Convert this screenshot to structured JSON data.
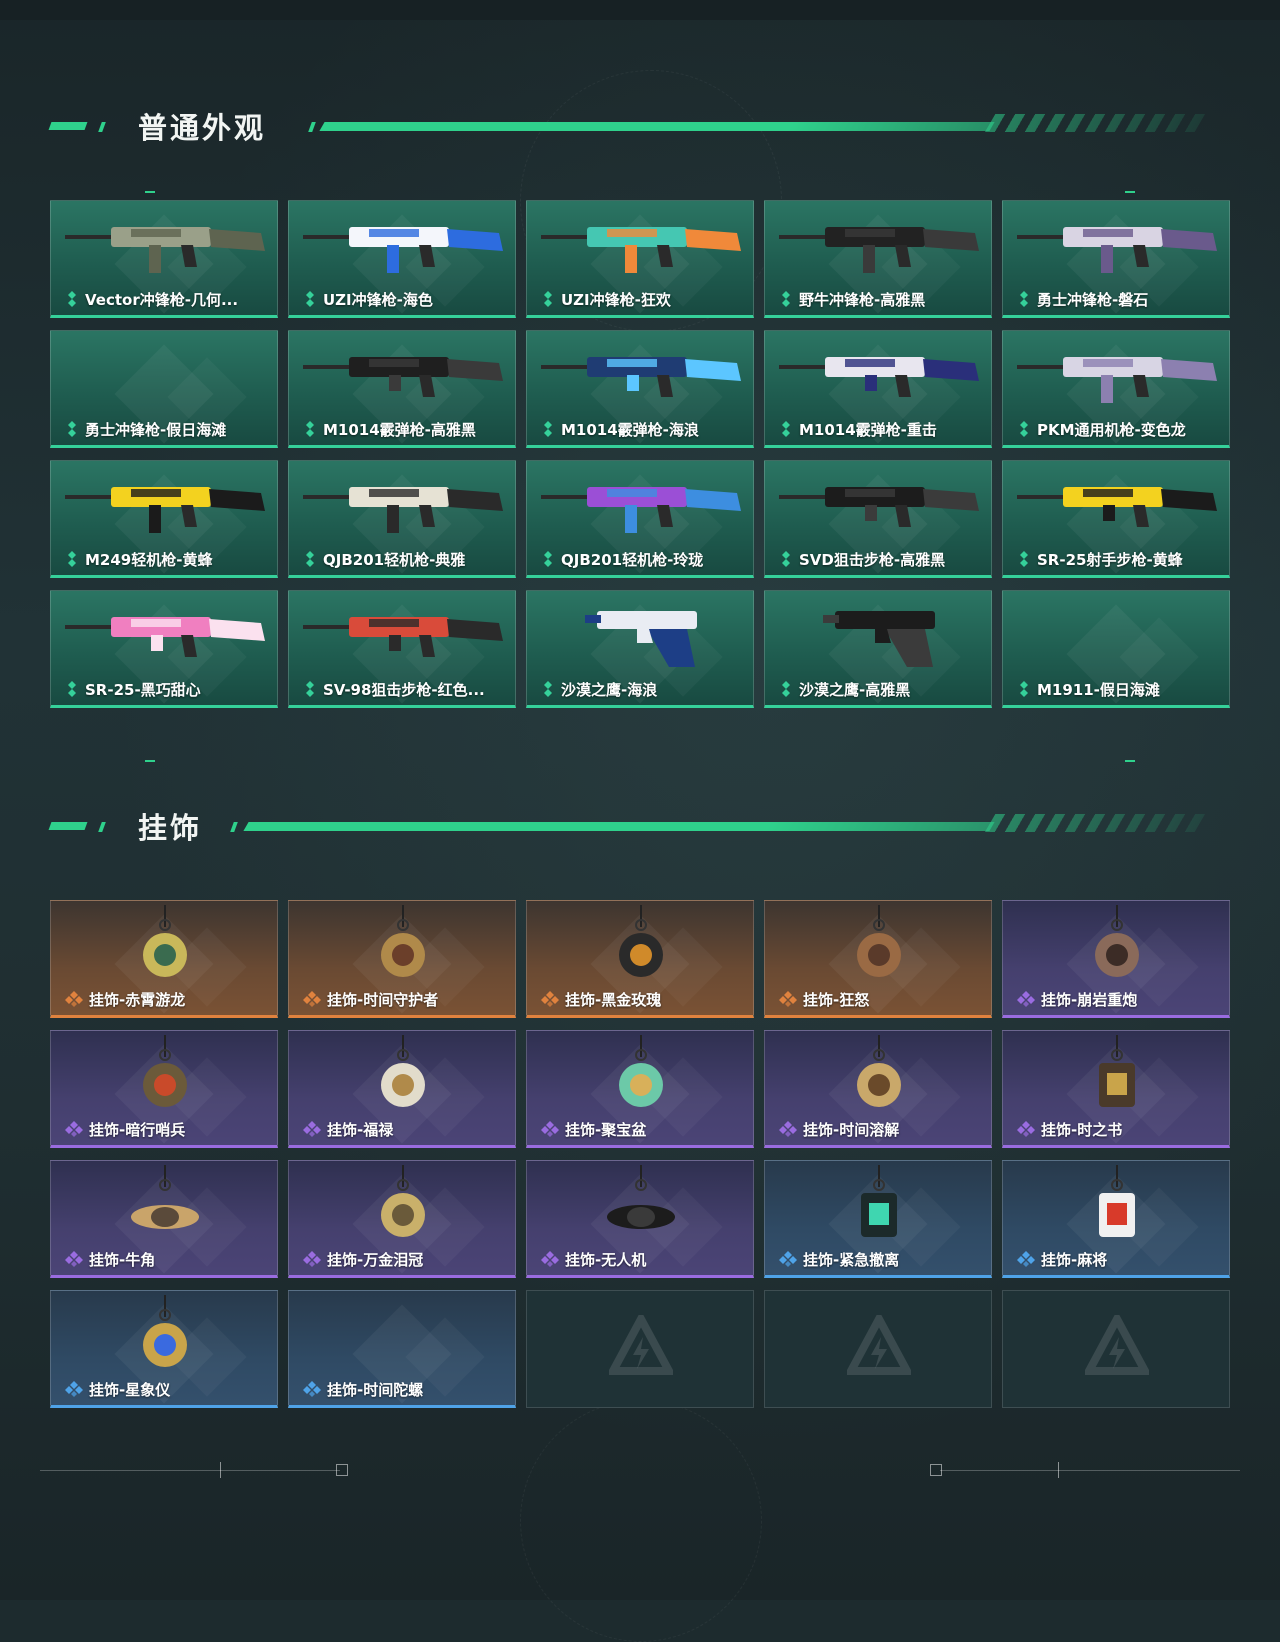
{
  "sections": {
    "normal": {
      "title": "普通外观"
    },
    "charms": {
      "title": "挂饰"
    }
  },
  "colors": {
    "accent": "#2fd18c",
    "rarity_green": "#35d19a",
    "rarity_orange": "#e0823e",
    "rarity_purple": "#9a6ce0",
    "rarity_blue": "#4fa3e8"
  },
  "skins": [
    {
      "label": "Vector冲锋枪-几何...",
      "rarity": "green",
      "icon": "smg-vector-icon",
      "colors": [
        "#9aa089",
        "#5e6450"
      ]
    },
    {
      "label": "UZI冲锋枪-海色",
      "rarity": "green",
      "icon": "smg-uzi-icon",
      "colors": [
        "#f4f6fb",
        "#2d6cdf"
      ]
    },
    {
      "label": "UZI冲锋枪-狂欢",
      "rarity": "green",
      "icon": "smg-uzi-icon",
      "colors": [
        "#45c7b2",
        "#f0893a"
      ]
    },
    {
      "label": "野牛冲锋枪-高雅黑",
      "rarity": "green",
      "icon": "smg-bizon-icon",
      "colors": [
        "#222222",
        "#3a3a3a"
      ]
    },
    {
      "label": "勇士冲锋枪-磐石",
      "rarity": "green",
      "icon": "smg-warrior-icon",
      "colors": [
        "#d9d4e3",
        "#6a5a8c"
      ]
    },
    {
      "label": "勇士冲锋枪-假日海滩",
      "rarity": "green",
      "icon": "",
      "colors": []
    },
    {
      "label": "M1014霰弹枪-高雅黑",
      "rarity": "green",
      "icon": "shotgun-m1014-icon",
      "colors": [
        "#1f1f1f",
        "#3a3a3a"
      ]
    },
    {
      "label": "M1014霰弹枪-海浪",
      "rarity": "green",
      "icon": "shotgun-m1014-icon",
      "colors": [
        "#1f3c73",
        "#5cc6ff"
      ]
    },
    {
      "label": "M1014霰弹枪-重击",
      "rarity": "green",
      "icon": "shotgun-m1014-icon",
      "colors": [
        "#e8e6ef",
        "#2a2f7a"
      ]
    },
    {
      "label": "PKM通用机枪-变色龙",
      "rarity": "green",
      "icon": "mg-pkm-icon",
      "colors": [
        "#d8d5e4",
        "#8c80b0"
      ]
    },
    {
      "label": "M249轻机枪-黄蜂",
      "rarity": "green",
      "icon": "mg-m249-icon",
      "colors": [
        "#f3d21f",
        "#1b1b1b"
      ]
    },
    {
      "label": "QJB201轻机枪-典雅",
      "rarity": "green",
      "icon": "mg-qjb201-icon",
      "colors": [
        "#e6e2d4",
        "#2a2a2a"
      ]
    },
    {
      "label": "QJB201轻机枪-玲珑",
      "rarity": "green",
      "icon": "mg-qjb201-icon",
      "colors": [
        "#9b4fd6",
        "#3d8ee0"
      ]
    },
    {
      "label": "SVD狙击步枪-高雅黑",
      "rarity": "green",
      "icon": "sniper-svd-icon",
      "colors": [
        "#1c1c1c",
        "#3b3b3b"
      ]
    },
    {
      "label": "SR-25射手步枪-黄蜂",
      "rarity": "green",
      "icon": "dmr-sr25-icon",
      "colors": [
        "#f3d21f",
        "#1b1b1b"
      ]
    },
    {
      "label": "SR-25-黑巧甜心",
      "rarity": "green",
      "icon": "dmr-sr25-icon",
      "colors": [
        "#f07fc0",
        "#fbe1ef"
      ]
    },
    {
      "label": "SV-98狙击步枪-红色...",
      "rarity": "green",
      "icon": "sniper-sv98-icon",
      "colors": [
        "#d94b3a",
        "#2a2a2a"
      ]
    },
    {
      "label": "沙漠之鹰-海浪",
      "rarity": "green",
      "icon": "pistol-deagle-icon",
      "colors": [
        "#e9ecf3",
        "#1d3e86"
      ]
    },
    {
      "label": "沙漠之鹰-高雅黑",
      "rarity": "green",
      "icon": "pistol-deagle-icon",
      "colors": [
        "#1c1c1c",
        "#3b3b3b"
      ]
    },
    {
      "label": "M1911-假日海滩",
      "rarity": "green",
      "icon": "",
      "colors": []
    }
  ],
  "charms": [
    {
      "label": "挂饰-赤霄游龙",
      "rarity": "orange",
      "icon": "dragon-charm-icon",
      "colors": [
        "#c9b85a",
        "#3a6b4f"
      ]
    },
    {
      "label": "挂饰-时间守护者",
      "rarity": "orange",
      "icon": "pendulum-charm-icon",
      "colors": [
        "#b08a4a",
        "#6b3f2a"
      ]
    },
    {
      "label": "挂饰-黑金玫瑰",
      "rarity": "orange",
      "icon": "rose-charm-icon",
      "colors": [
        "#2a2a2a",
        "#d08a2a"
      ]
    },
    {
      "label": "挂饰-狂怒",
      "rarity": "orange",
      "icon": "key-charm-icon",
      "colors": [
        "#9a6a44",
        "#5a3a2a"
      ]
    },
    {
      "label": "挂饰-崩岩重炮",
      "rarity": "purple",
      "icon": "golem-charm-icon",
      "colors": [
        "#8a6a5a",
        "#3c2c26"
      ]
    },
    {
      "label": "挂饰-暗行哨兵",
      "rarity": "purple",
      "icon": "sentinel-charm-icon",
      "colors": [
        "#6b5a3a",
        "#c94a2a"
      ]
    },
    {
      "label": "挂饰-福禄",
      "rarity": "purple",
      "icon": "gourd-charm-icon",
      "colors": [
        "#e2dccb",
        "#b08a4a"
      ]
    },
    {
      "label": "挂饰-聚宝盆",
      "rarity": "purple",
      "icon": "treasure-bowl-charm-icon",
      "colors": [
        "#6cc9a8",
        "#d8b05a"
      ]
    },
    {
      "label": "挂饰-时间溶解",
      "rarity": "purple",
      "icon": "melting-clock-charm-icon",
      "colors": [
        "#c9a86a",
        "#6a4a2a"
      ]
    },
    {
      "label": "挂饰-时之书",
      "rarity": "purple",
      "icon": "book-charm-icon",
      "colors": [
        "#4a3a2a",
        "#c9a44a"
      ]
    },
    {
      "label": "挂饰-牛角",
      "rarity": "purple",
      "icon": "horns-charm-icon",
      "colors": [
        "#c9a46a",
        "#5a4a3a"
      ]
    },
    {
      "label": "挂饰-万金泪冠",
      "rarity": "purple",
      "icon": "crown-charm-icon",
      "colors": [
        "#c9b06a",
        "#6a5a3a"
      ]
    },
    {
      "label": "挂饰-无人机",
      "rarity": "purple",
      "icon": "drone-charm-icon",
      "colors": [
        "#1c1c1c",
        "#3a3a3a"
      ]
    },
    {
      "label": "挂饰-紧急撤离",
      "rarity": "blue",
      "icon": "evac-charm-icon",
      "colors": [
        "#1c2a2a",
        "#3fd6b0"
      ]
    },
    {
      "label": "挂饰-麻将",
      "rarity": "blue",
      "icon": "mahjong-charm-icon",
      "colors": [
        "#f0f0f0",
        "#d83a2a"
      ]
    },
    {
      "label": "挂饰-星象仪",
      "rarity": "blue",
      "icon": "astrolabe-charm-icon",
      "colors": [
        "#c9a44a",
        "#3a6ae0"
      ]
    },
    {
      "label": "挂饰-时间陀螺",
      "rarity": "blue",
      "icon": "",
      "colors": []
    },
    {
      "label": "",
      "rarity": "empty",
      "icon": "logo-placeholder-icon",
      "colors": []
    },
    {
      "label": "",
      "rarity": "empty",
      "icon": "logo-placeholder-icon",
      "colors": []
    },
    {
      "label": "",
      "rarity": "empty",
      "icon": "logo-placeholder-icon",
      "colors": []
    }
  ]
}
